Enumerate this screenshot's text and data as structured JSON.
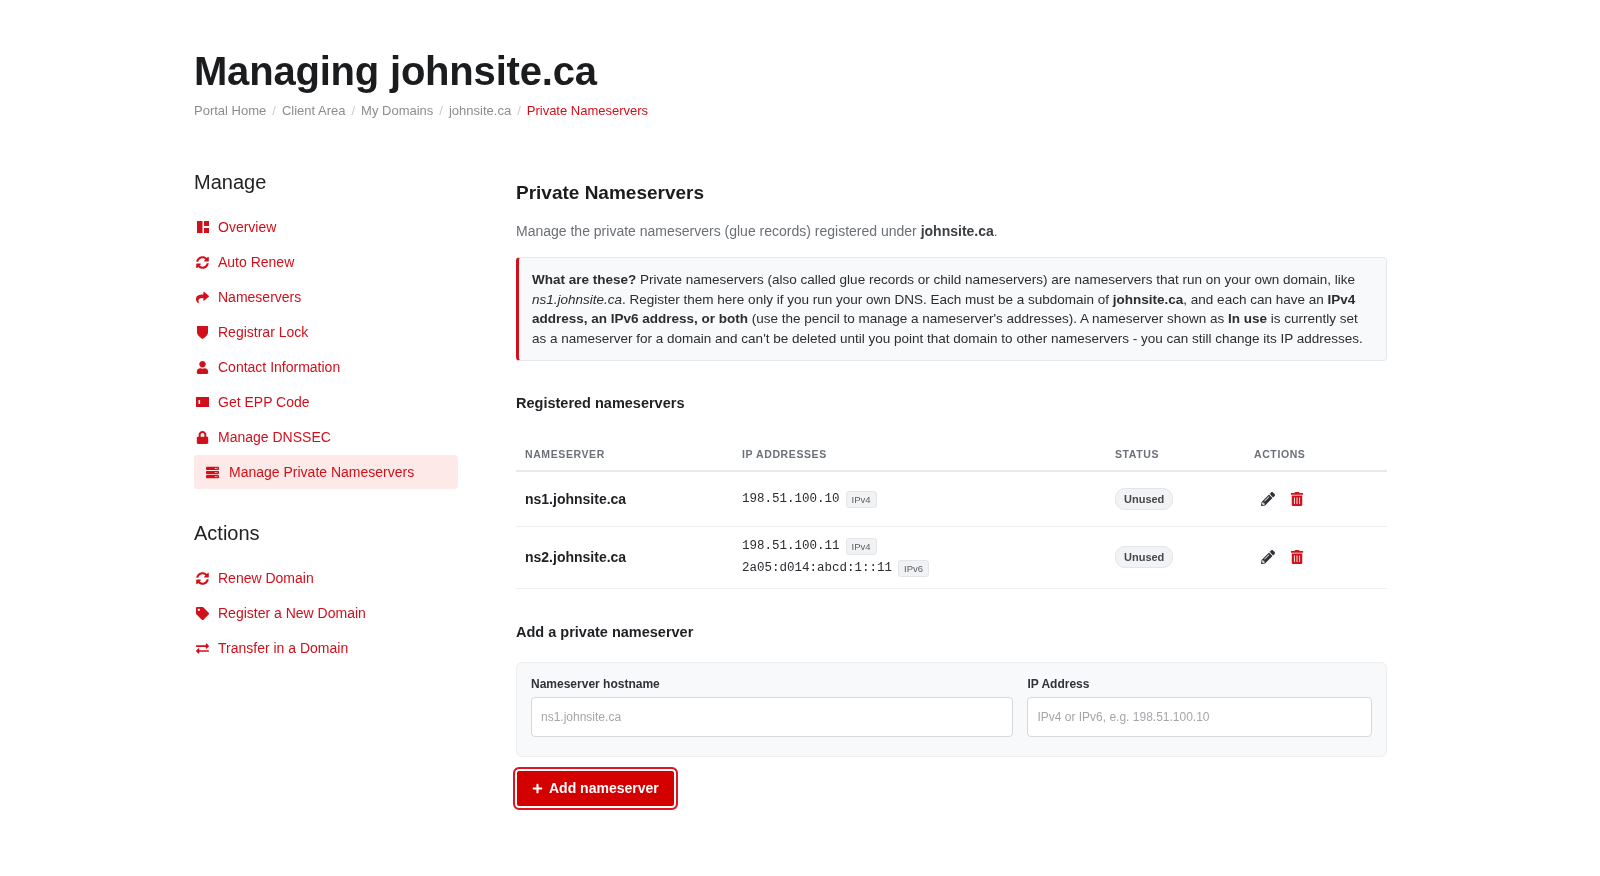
{
  "page": {
    "title": "Managing johnsite.ca"
  },
  "breadcrumb": {
    "separator": "/",
    "items": [
      {
        "label": "Portal Home",
        "selected": false
      },
      {
        "label": "Client Area",
        "selected": false
      },
      {
        "label": "My Domains",
        "selected": false
      },
      {
        "label": "johnsite.ca",
        "selected": false
      },
      {
        "label": "Private Nameservers",
        "selected": true
      }
    ]
  },
  "sidebar": {
    "sections": [
      {
        "heading": "Manage",
        "items": [
          {
            "label": "Overview",
            "selected": false
          },
          {
            "label": "Auto Renew",
            "selected": false
          },
          {
            "label": "Nameservers",
            "selected": false
          },
          {
            "label": "Registrar Lock",
            "selected": false
          },
          {
            "label": "Contact Information",
            "selected": false
          },
          {
            "label": "Get EPP Code",
            "selected": false
          },
          {
            "label": "Manage DNSSEC",
            "selected": false
          },
          {
            "label": "Manage Private Nameservers",
            "selected": true
          }
        ]
      },
      {
        "heading": "Actions",
        "items": [
          {
            "label": "Renew Domain",
            "selected": false
          },
          {
            "label": "Register a New Domain",
            "selected": false
          },
          {
            "label": "Transfer in a Domain",
            "selected": false
          }
        ]
      }
    ]
  },
  "main": {
    "heading": "Private Nameservers",
    "description": "Manage the private nameservers (glue records) registered under **johnsite.ca**.",
    "info_box": "**What are these?** Private nameservers (also called glue records or child nameservers) are nameservers that run on your own domain, like *ns1.johnsite.ca*. Register them here only if you run your own DNS. Each must be a subdomain of **johnsite.ca**, and each can have an **IPv4 address, an IPv6 address, or both** (use the pencil to manage a nameserver's addresses). A nameserver shown as **In use** is currently set as a nameserver for a domain and can't be deleted until you point that domain to other nameservers - you can still change its IP addresses.",
    "registered": {
      "heading": "Registered nameservers",
      "columns": [
        "NAMESERVER",
        "IP ADDRESSES",
        "STATUS",
        "ACTIONS"
      ],
      "rows": [
        {
          "nameserver": "ns1.johnsite.ca",
          "addresses": [
            {
              "ip": "198.51.100.10",
              "type": "IPv4"
            }
          ],
          "status": "Unused"
        },
        {
          "nameserver": "ns2.johnsite.ca",
          "addresses": [
            {
              "ip": "198.51.100.11",
              "type": "IPv4"
            },
            {
              "ip": "2a05:d014:abcd:1::11",
              "type": "IPv6"
            }
          ],
          "status": "Unused"
        }
      ]
    },
    "add_form": {
      "heading": "Add a private nameserver",
      "fields": [
        {
          "label": "Nameserver hostname",
          "placeholder": "ns1.johnsite.ca"
        },
        {
          "label": "IP Address",
          "placeholder": "IPv4 or IPv6, e.g. 198.51.100.10"
        }
      ],
      "submit": {
        "label": "Add nameserver",
        "focused": true
      }
    }
  }
}
